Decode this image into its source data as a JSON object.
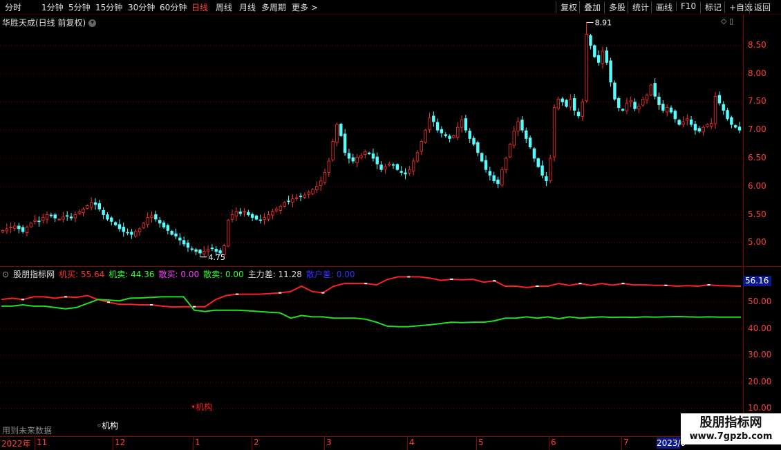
{
  "toolbar": {
    "left_items": [
      "分时",
      "1分钟",
      "5分钟",
      "15分钟",
      "30分钟",
      "60分钟",
      "日线",
      "周线",
      "月线",
      "多周期",
      "更多 >"
    ],
    "active": "日线",
    "right_items": [
      "复权",
      "叠加",
      "多股",
      "统计",
      "画线",
      "F10",
      "标记",
      "+自选",
      "返回"
    ]
  },
  "stock": {
    "title": "华胜天成(日线 前复权)",
    "dropdown_icon": "chevron-down-icon"
  },
  "indicator": {
    "name": "股朋指标网",
    "legend": [
      {
        "text": "机买: 55.64",
        "color": "#ff3030"
      },
      {
        "text": "机卖: 44.36",
        "color": "#30ff30"
      },
      {
        "text": "散买: 0.00",
        "color": "#ff40ff"
      },
      {
        "text": "散卖: 0.00",
        "color": "#30ff30"
      },
      {
        "text": "主力差: 11.28",
        "color": "#dddddd"
      },
      {
        "text": "散户差: 0.00",
        "color": "#3030ff"
      }
    ],
    "current_value": "56.16"
  },
  "annotations": {
    "high": "8.91",
    "low": "4.75",
    "inst_red": "•机构",
    "inst_white": "◦机构",
    "future_note": "用到未来数据"
  },
  "dates": [
    "2022年",
    "11",
    "12",
    "1",
    "2",
    "3",
    "4",
    "5",
    "6",
    "7",
    "2023/0"
  ],
  "watermark": {
    "line1": "股朋指标网",
    "line2": "www.7gpzb.com"
  },
  "colors": {
    "up": "#ff3232",
    "down": "#54ffff",
    "grid": "#7a0000",
    "buy_line": "#ff2020",
    "sell_line": "#20e020"
  },
  "chart_data": [
    {
      "type": "candlestick",
      "title": "华胜天成(日线 前复权)",
      "y_ticks": [
        "8.50",
        "8.00",
        "7.50",
        "7.00",
        "6.50",
        "6.00",
        "5.50",
        "5.00"
      ],
      "ylim": [
        4.6,
        9.05
      ],
      "high_label": 8.91,
      "low_label": 4.75,
      "close_series": [
        5.22,
        5.25,
        5.28,
        5.3,
        5.25,
        5.2,
        5.28,
        5.35,
        5.4,
        5.38,
        5.45,
        5.5,
        5.48,
        5.44,
        5.42,
        5.46,
        5.48,
        5.44,
        5.5,
        5.55,
        5.6,
        5.66,
        5.72,
        5.68,
        5.6,
        5.5,
        5.42,
        5.38,
        5.32,
        5.25,
        5.2,
        5.18,
        5.15,
        5.2,
        5.25,
        5.35,
        5.45,
        5.48,
        5.42,
        5.35,
        5.28,
        5.22,
        5.15,
        5.12,
        5.05,
        4.98,
        4.92,
        4.88,
        4.85,
        4.82,
        4.85,
        4.88,
        4.9,
        4.85,
        4.82,
        4.95,
        5.4,
        5.5,
        5.55,
        5.52,
        5.56,
        5.5,
        5.45,
        5.42,
        5.4,
        5.45,
        5.5,
        5.55,
        5.6,
        5.65,
        5.72,
        5.74,
        5.78,
        5.8,
        5.82,
        5.85,
        5.9,
        5.95,
        6.0,
        6.1,
        6.25,
        6.45,
        6.8,
        7.1,
        6.9,
        6.6,
        6.5,
        6.45,
        6.52,
        6.55,
        6.62,
        6.58,
        6.5,
        6.4,
        6.3,
        6.35,
        6.4,
        6.38,
        6.3,
        6.25,
        6.22,
        6.3,
        6.45,
        6.6,
        6.8,
        7.0,
        7.22,
        7.15,
        7.0,
        6.95,
        6.9,
        6.85,
        6.9,
        7.05,
        7.18,
        7.0,
        6.85,
        6.75,
        6.6,
        6.45,
        6.3,
        6.2,
        6.1,
        6.05,
        6.3,
        6.5,
        6.75,
        6.98,
        7.15,
        7.0,
        6.85,
        6.7,
        6.5,
        6.35,
        6.2,
        6.1,
        6.5,
        7.4,
        7.55,
        7.5,
        7.42,
        7.55,
        7.35,
        7.25,
        7.5,
        8.7,
        8.5,
        8.3,
        8.2,
        8.4,
        8.2,
        7.85,
        7.55,
        7.4,
        7.35,
        7.48,
        7.52,
        7.38,
        7.42,
        7.55,
        7.62,
        7.8,
        7.6,
        7.45,
        7.35,
        7.4,
        7.32,
        7.2,
        7.1,
        7.15,
        7.2,
        7.1,
        7.0,
        6.98,
        7.05,
        7.1,
        7.12,
        7.6,
        7.48,
        7.35,
        7.2,
        7.1,
        7.05,
        7.0
      ]
    },
    {
      "type": "line",
      "y_ticks": [
        "50.00",
        "40.00",
        "30.00",
        "20.00",
        "10.00"
      ],
      "ylim": [
        0,
        63
      ],
      "series": [
        {
          "name": "机买",
          "color": "#ff2020",
          "values": [
            51,
            51.5,
            51,
            52,
            52,
            51.5,
            52,
            51.8,
            52.5,
            51,
            50,
            49.2,
            49.2,
            49,
            49,
            48.5,
            48.2,
            48.3,
            48.3,
            48.3,
            51,
            52.5,
            53,
            53,
            53,
            53.2,
            53.5,
            54,
            56,
            54,
            53.5,
            56,
            57,
            57,
            57,
            56.5,
            58.5,
            59.5,
            59.5,
            59.5,
            59,
            58.2,
            58.6,
            58.4,
            58.6,
            57.5,
            58,
            56,
            56,
            55.5,
            56,
            56,
            57,
            56.3,
            57,
            56.3,
            57,
            56.4,
            57,
            56.5,
            56.5,
            56.3,
            56.3,
            56,
            56.2,
            56,
            56.5,
            56.2,
            56.1,
            56
          ]
        },
        {
          "name": "机卖",
          "color": "#20e020",
          "values": [
            48.5,
            48.5,
            49,
            48.5,
            48.5,
            48,
            47.5,
            48,
            49.5,
            51,
            50.8,
            50.5,
            51.5,
            51.6,
            51.8,
            52,
            52,
            52,
            47,
            46.5,
            47,
            47,
            47,
            46.8,
            46.5,
            46.2,
            46,
            44,
            45,
            44.5,
            44.5,
            44,
            44,
            44,
            43.6,
            42.5,
            41,
            40.8,
            40.8,
            41.2,
            41.5,
            42,
            42.5,
            42.3,
            42.5,
            42.5,
            43,
            44,
            44,
            44.5,
            44,
            44.5,
            43.8,
            44.5,
            44,
            44.3,
            44.5,
            44.3,
            44.4,
            44.3,
            44.5,
            44.4,
            44.5,
            44.6,
            44.5,
            44.4,
            44.5,
            44.4,
            44.4,
            44.4
          ]
        }
      ]
    }
  ]
}
